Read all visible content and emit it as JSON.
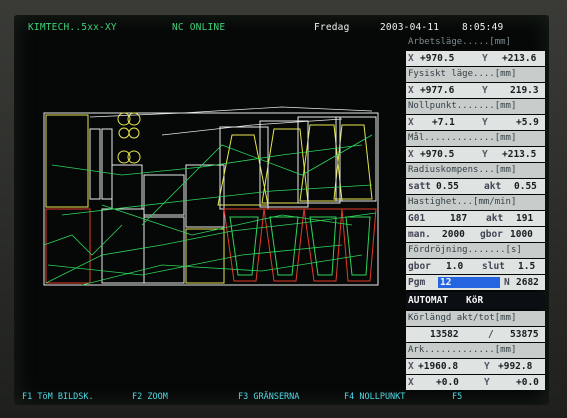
{
  "header": {
    "app_title": "KIMTECH..5xx-XY",
    "status": "NC ONLINE",
    "weekday": "Fredag",
    "date": "2003-04-11",
    "time": "8:05:49"
  },
  "panel": {
    "arbets_label": "Arbetsläge.....[mm]",
    "arbets_x": "+970.5",
    "arbets_y": "+213.6",
    "fysiskt_label": "Fysiskt läge....[mm]",
    "fysiskt_x": "+977.6",
    "fysiskt_y": "219.3",
    "nollpunkt_label": "Nollpunkt.......[mm]",
    "nollpunkt_x": "+7.1",
    "nollpunkt_y": "+5.9",
    "mal_label": "Mål.............[mm]",
    "mal_x": "+970.5",
    "mal_y": "+213.5",
    "radius_label": "Radiuskompens...[mm]",
    "radius_satt_label": "satt",
    "radius_satt": "0.55",
    "radius_akt_label": "akt",
    "radius_akt": "0.55",
    "hast_label": "Hastighet...[mm/min]",
    "g01_label": "G01",
    "g01": "187",
    "g01_akt_label": "akt",
    "g01_akt": "191",
    "man_label": "man.",
    "man": "2000",
    "gbor_label": "gbor",
    "gbor": "1000",
    "ford_label": "Fördröjning.......[s]",
    "ford_gbor_label": "gbor",
    "ford_gbor": "1.0",
    "ford_slut_label": "slut",
    "ford_slut": "1.5",
    "pgm_label": "Pgm",
    "pgm": "12",
    "n_label": "N",
    "n": "2682",
    "mode": "AUTOMAT",
    "mode_state": "KöR",
    "korlangd_label": "Körlängd akt/tot[mm]",
    "korlangd_akt": "13582",
    "korlangd_sep": "/",
    "korlangd_tot": "53875",
    "ark_label": "Ark.............[mm]",
    "ark_x": "+1960.8",
    "ark_y": "+992.8",
    "ark2_x": "+0.0",
    "ark2_y": "+0.0",
    "x_label": "X",
    "y_label": "Y"
  },
  "fkeys": [
    {
      "label": "F1 TöM BILDSK."
    },
    {
      "label": "F2 ZOOM"
    },
    {
      "label": "F3 GRÄNSERNA"
    },
    {
      "label": "F4 NOLLPUNKT"
    },
    {
      "label": "F5"
    }
  ],
  "colors": {
    "background": "#060807",
    "header_text": "#3fd07a",
    "panel_bar": "#dfe3e2",
    "pgm_highlight": "#2566e0",
    "fkey_text": "#4fd9e6",
    "drawing_white": "#e8e8e8",
    "drawing_green": "#2fd35a",
    "drawing_yellow": "#e6e64c",
    "drawing_red": "#e23a2a"
  }
}
